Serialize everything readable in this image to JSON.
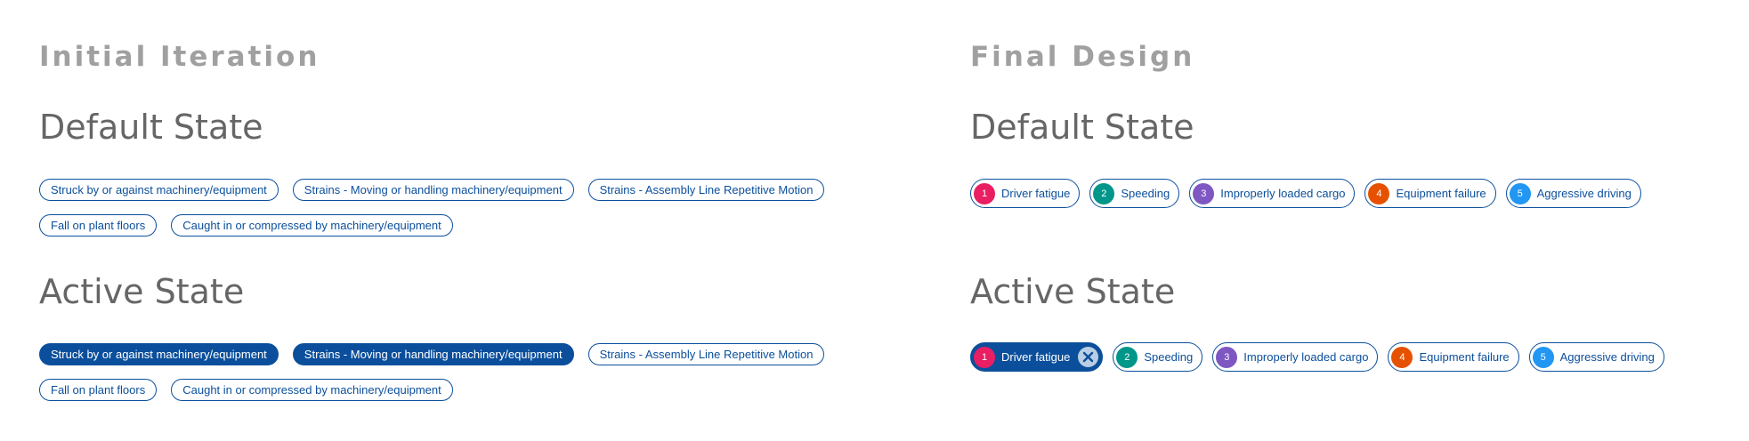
{
  "initial": {
    "title": "Initial Iteration",
    "default_title": "Default State",
    "active_title": "Active State",
    "chips": [
      "Struck by or against machinery/equipment",
      "Strains - Moving or handling machinery/equipment",
      "Strains - Assembly Line Repetitive Motion",
      "Fall on plant floors",
      "Caught in or compressed by machinery/equipment"
    ],
    "active_selected": [
      0,
      1
    ]
  },
  "final": {
    "title": "Final Design",
    "default_title": "Default State",
    "active_title": "Active State",
    "pills": [
      {
        "num": "1",
        "label": "Driver fatigue",
        "color": "#e91e63"
      },
      {
        "num": "2",
        "label": "Speeding",
        "color": "#00968a"
      },
      {
        "num": "3",
        "label": "Improperly loaded cargo",
        "color": "#7e57c2"
      },
      {
        "num": "4",
        "label": "Equipment failure",
        "color": "#e65100"
      },
      {
        "num": "5",
        "label": "Aggressive driving",
        "color": "#2196f3"
      }
    ],
    "active_selected": [
      0
    ],
    "close_icon": "close-icon"
  },
  "colors": {
    "primary": "#0b4f9c",
    "heading_gray": "#a0a0a0",
    "state_gray": "#666666",
    "close_bg": "#b9cde4"
  }
}
